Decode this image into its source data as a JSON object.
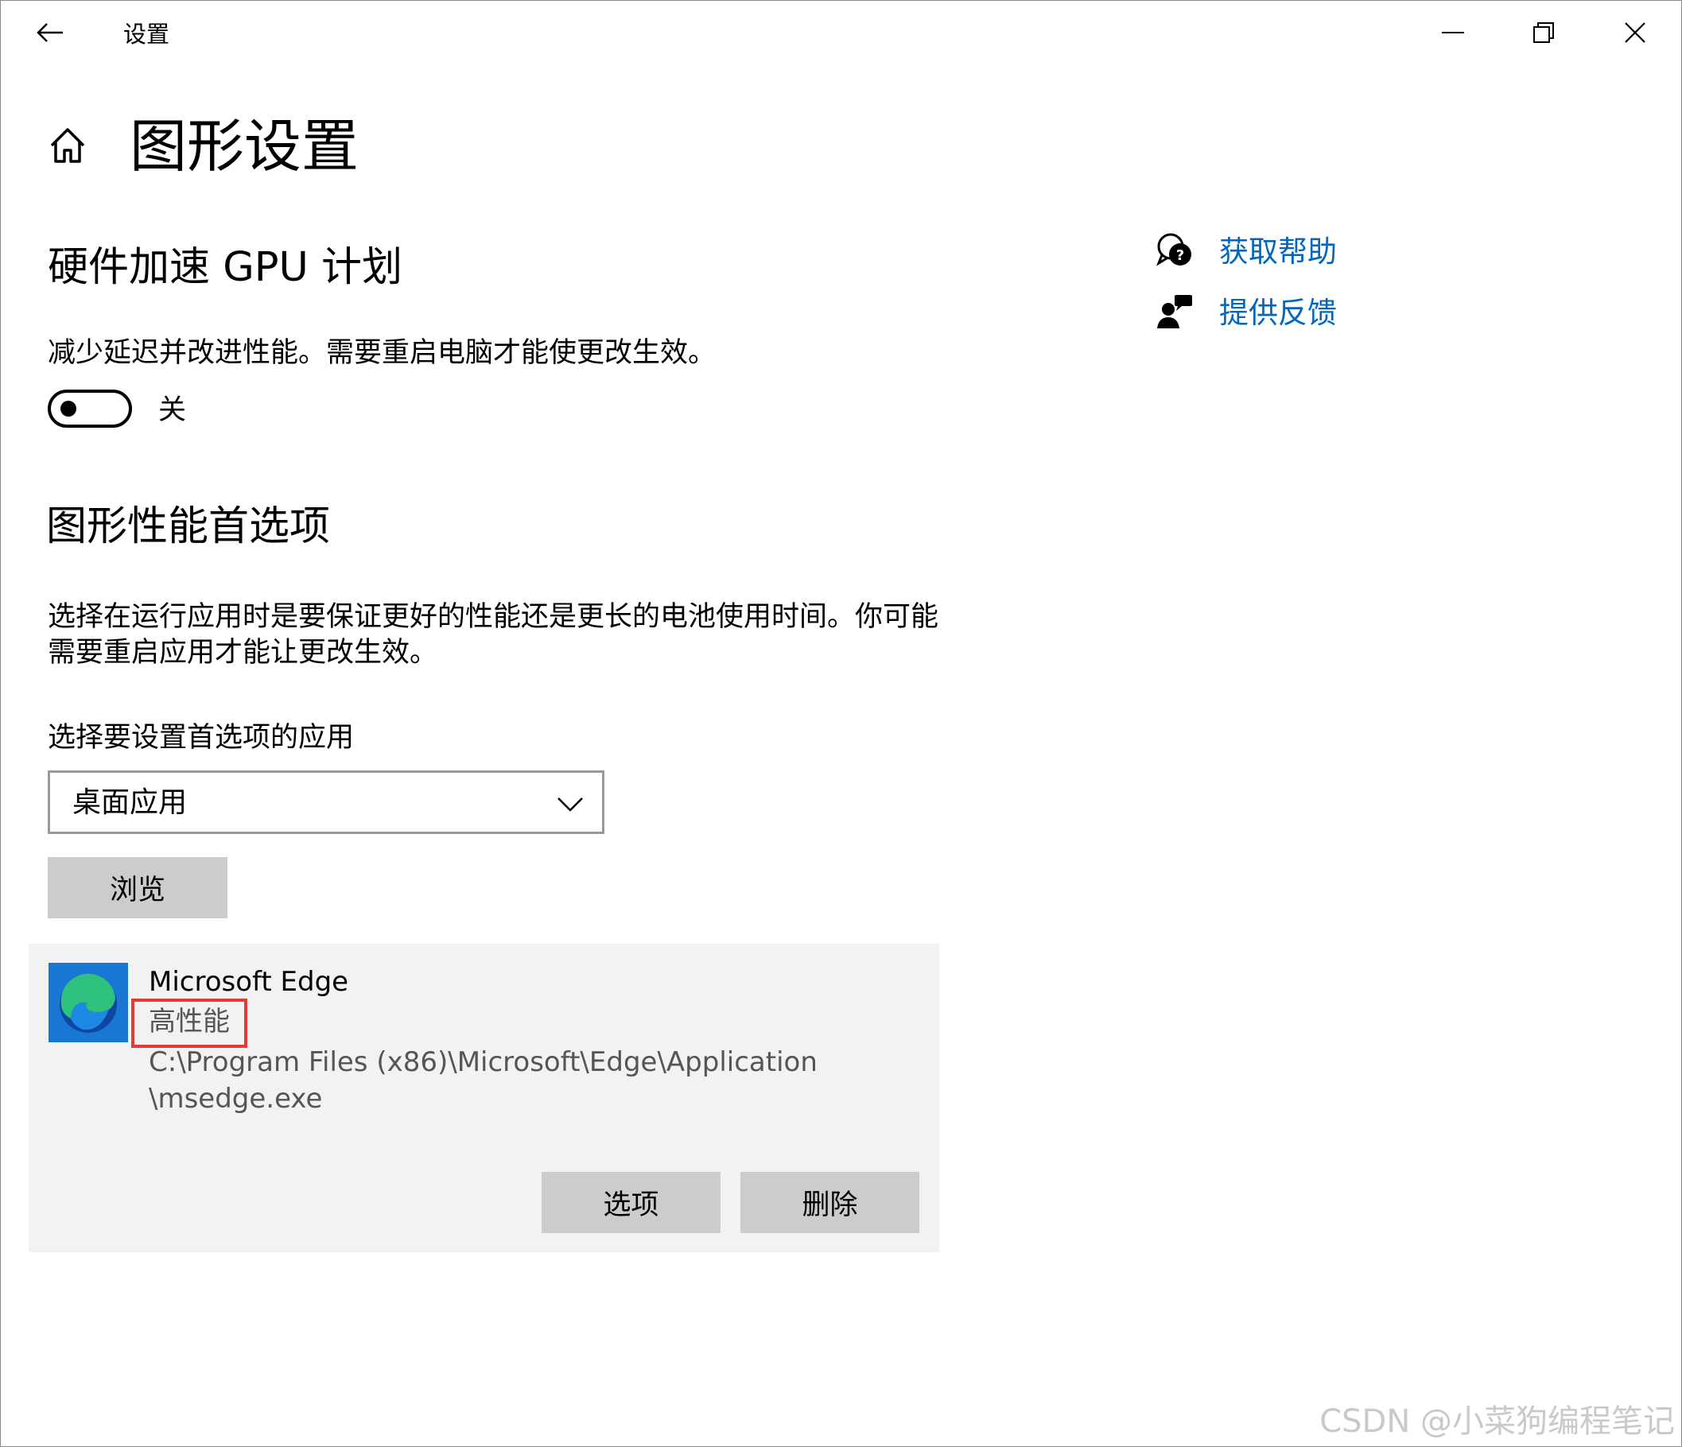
{
  "window": {
    "title": "设置"
  },
  "page": {
    "title": "图形设置"
  },
  "gpu_section": {
    "heading": "硬件加速 GPU 计划",
    "description": "减少延迟并改进性能。需要重启电脑才能使更改生效。",
    "toggle_state": "关"
  },
  "pref_section": {
    "heading": "图形性能首选项",
    "description_line1": "选择在运行应用时是要保证更好的性能还是更长的电池使用时间。你可能",
    "description_line2": "需要重启应用才能让更改生效。",
    "select_label": "选择要设置首选项的应用",
    "select_value": "桌面应用",
    "browse_label": "浏览"
  },
  "app_entry": {
    "name": "Microsoft Edge",
    "performance": "高性能",
    "path_line1": "C:\\Program Files (x86)\\Microsoft\\Edge\\Application",
    "path_line2": "\\msedge.exe",
    "options_label": "选项",
    "delete_label": "删除"
  },
  "side_links": {
    "help": "获取帮助",
    "feedback": "提供反馈"
  },
  "watermark": "CSDN @小菜狗编程笔记",
  "colors": {
    "link": "#0067c0",
    "button_bg": "#cccccc",
    "card_bg": "#f2f2f2",
    "highlight": "#e53935"
  }
}
